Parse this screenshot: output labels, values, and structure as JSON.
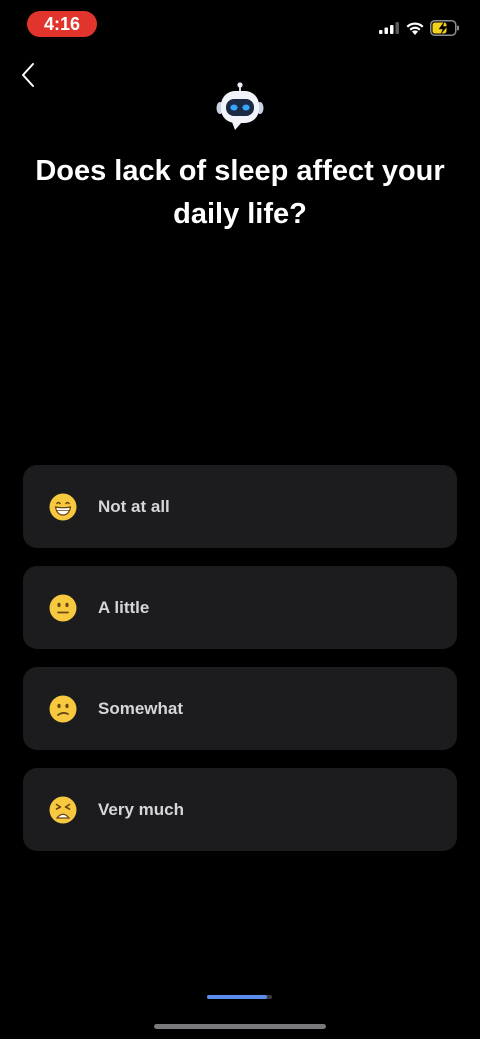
{
  "status_bar": {
    "time": "4:16",
    "signal_icon": "cellular-signal-icon",
    "wifi_icon": "wifi-icon",
    "battery_icon": "battery-charging-icon"
  },
  "header": {
    "back_icon": "chevron-left-icon",
    "mascot_icon": "robot-icon"
  },
  "question": "Does lack of sleep affect your daily life?",
  "options": [
    {
      "label": "Not at all",
      "emoji": "😁",
      "icon": "grinning-face-icon"
    },
    {
      "label": "A little",
      "emoji": "😐",
      "icon": "neutral-face-icon"
    },
    {
      "label": "Somewhat",
      "emoji": "😕",
      "icon": "confused-face-icon"
    },
    {
      "label": "Very much",
      "emoji": "😫",
      "icon": "tired-face-icon"
    }
  ],
  "progress": {
    "fraction": 0.92
  },
  "colors": {
    "background": "#000000",
    "card": "#1c1c1e",
    "accent": "#5b8def",
    "time_pill": "#e0342c"
  }
}
